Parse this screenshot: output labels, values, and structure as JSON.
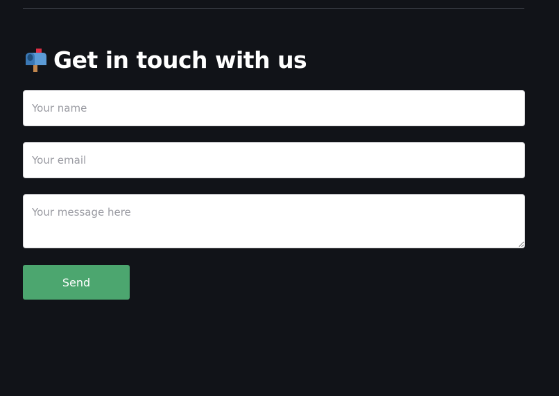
{
  "form": {
    "heading": "Get in touch with us",
    "heading_icon": "mailbox-icon",
    "name_placeholder": "Your name",
    "email_placeholder": "Your email",
    "message_placeholder": "Your message here",
    "send_label": "Send"
  },
  "colors": {
    "background": "#111318",
    "button": "#4ca66f",
    "text": "#ffffff"
  }
}
